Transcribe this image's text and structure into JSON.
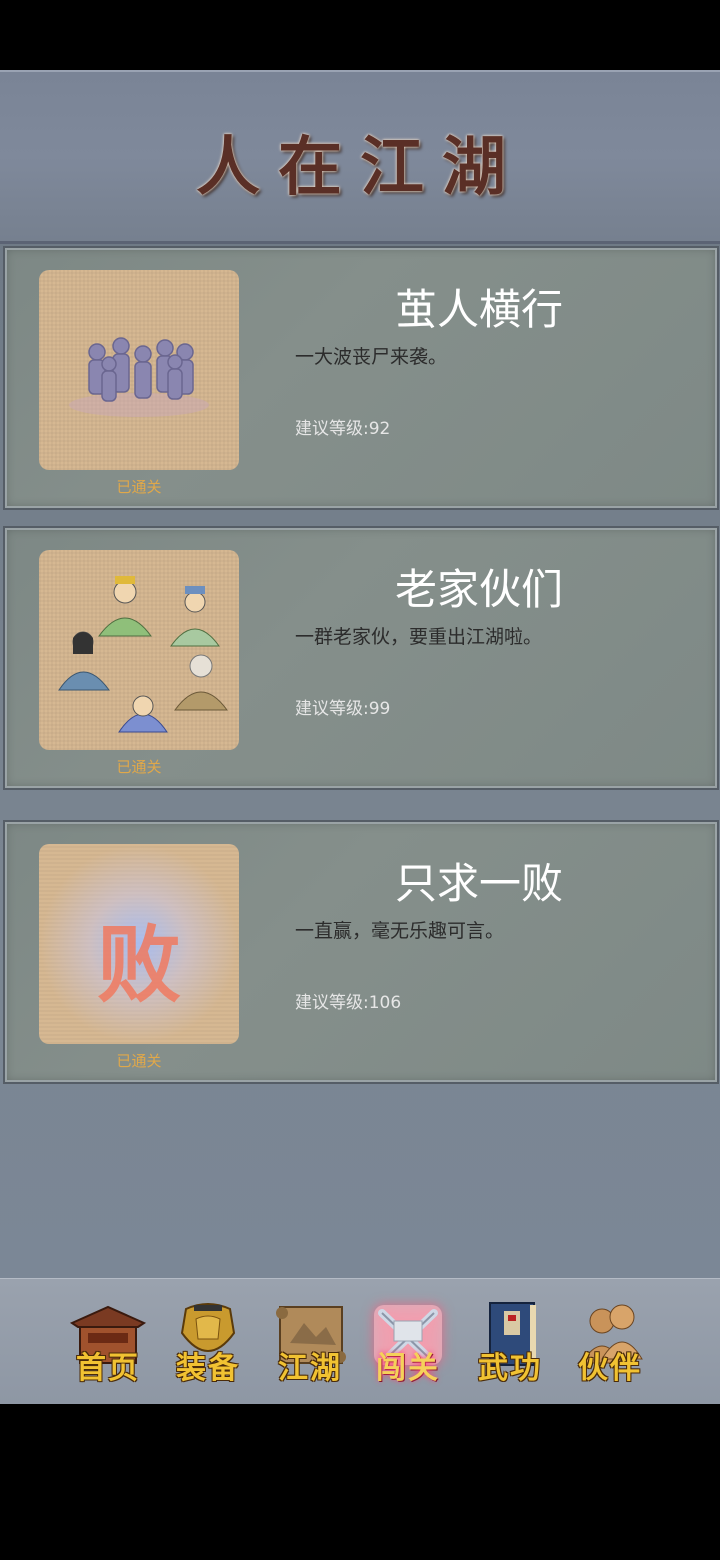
{
  "header": {
    "title": "人在江湖"
  },
  "stages": [
    {
      "title": "茧人横行",
      "description": "一大波丧尸来袭。",
      "level": "建议等级:92",
      "status": "已通关",
      "thumb": "zombies"
    },
    {
      "title": "老家伙们",
      "description": "一群老家伙，要重出江湖啦。",
      "level": "建议等级:99",
      "status": "已通关",
      "thumb": "elders"
    },
    {
      "title": "只求一败",
      "description": "一直赢，毫无乐趣可言。",
      "level": "建议等级:106",
      "status": "已通关",
      "thumb": "defeat-character",
      "thumb_glyph": "败"
    }
  ],
  "nav": [
    {
      "label": "首页",
      "icon": "temple-icon"
    },
    {
      "label": "装备",
      "icon": "armor-icon"
    },
    {
      "label": "江湖",
      "icon": "scroll-map-icon"
    },
    {
      "label": "闯关",
      "icon": "crossed-swords-icon",
      "active": true
    },
    {
      "label": "武功",
      "icon": "book-icon"
    },
    {
      "label": "伙伴",
      "icon": "companions-icon"
    }
  ],
  "colors": {
    "status": "#e0a84a",
    "nav_label": "#f1c232",
    "title": "#5a2f26"
  }
}
